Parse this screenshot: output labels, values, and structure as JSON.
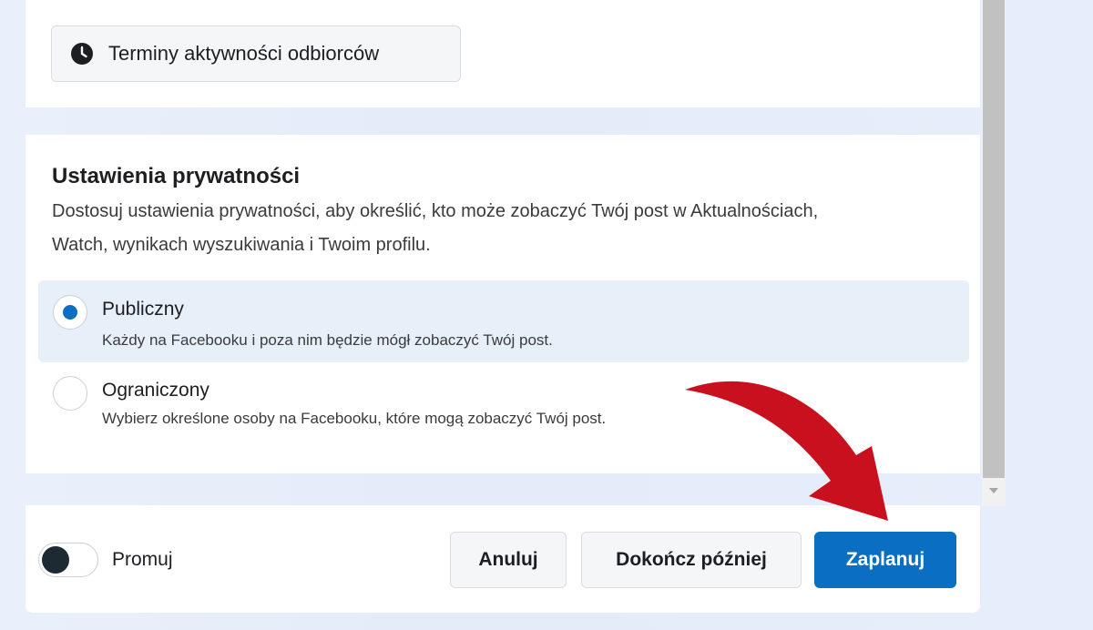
{
  "audience_button": {
    "label": "Terminy aktywności odbiorców",
    "icon": "clock-icon"
  },
  "privacy": {
    "title": "Ustawienia prywatności",
    "description": "Dostosuj ustawienia prywatności, aby określić, kto może zobaczyć Twój post w Aktualnościach, Watch, wynikach wyszukiwania i Twoim profilu.",
    "options": [
      {
        "label": "Publiczny",
        "sub": "Każdy na Facebooku i poza nim będzie mógł zobaczyć Twój post.",
        "selected": true
      },
      {
        "label": "Ograniczony",
        "sub": "Wybierz określone osoby na Facebooku, które mogą zobaczyć Twój post.",
        "selected": false
      }
    ]
  },
  "footer": {
    "promote_label": "Promuj",
    "promote_on": false,
    "cancel_label": "Anuluj",
    "later_label": "Dokończ później",
    "schedule_label": "Zaplanuj"
  },
  "colors": {
    "accent": "#0a6fc2",
    "arrow": "#c8101e",
    "selected_bg": "#e7eff9"
  }
}
